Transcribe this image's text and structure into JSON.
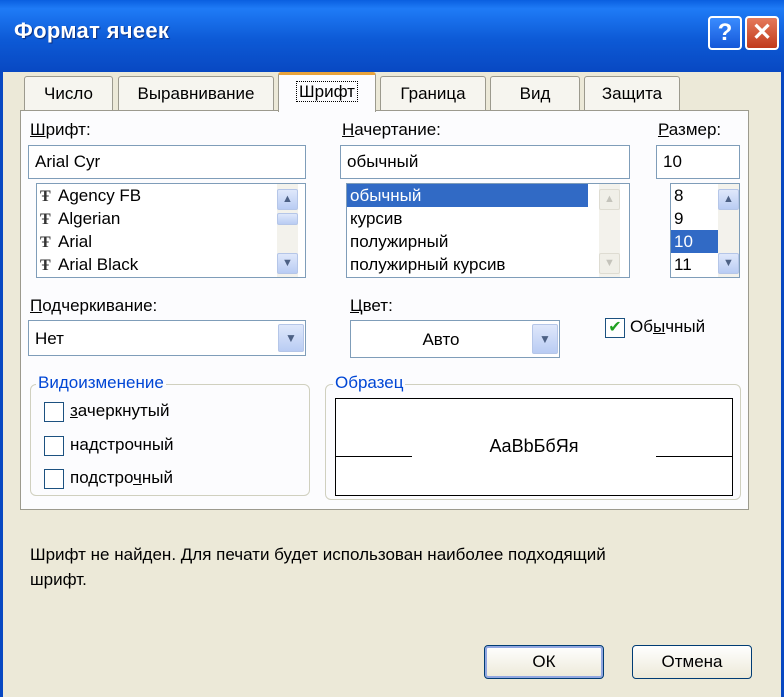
{
  "window": {
    "title": "Формат ячеек",
    "help_label": "?",
    "close_label": "✕"
  },
  "tabs": [
    {
      "label": "Число"
    },
    {
      "label": "Выравнивание"
    },
    {
      "label": "Шрифт",
      "active": true
    },
    {
      "label": "Граница"
    },
    {
      "label": "Вид"
    },
    {
      "label": "Защита"
    }
  ],
  "font": {
    "label_first": "Ш",
    "label_rest": "рифт:",
    "value": "Arial Cyr",
    "items": [
      "Agency FB",
      "Algerian",
      "Arial",
      "Arial Black"
    ],
    "icon_glyph": "Ŧ"
  },
  "style": {
    "label_first": "Н",
    "label_rest": "ачертание:",
    "value": "обычный",
    "items": [
      "обычный",
      "курсив",
      "полужирный",
      "полужирный курсив"
    ],
    "selected": "обычный"
  },
  "size": {
    "label_first": "Р",
    "label_rest": "азмер:",
    "value": "10",
    "items": [
      "8",
      "9",
      "10",
      "11"
    ],
    "selected": "10"
  },
  "underline": {
    "label_first": "П",
    "label_rest": "одчеркивание:",
    "value": "Нет"
  },
  "color": {
    "label_first": "Ц",
    "label_rest": "вет:",
    "value": "Авто"
  },
  "normal": {
    "label_a": "Об",
    "label_u": "ы",
    "label_b": "чный",
    "checked": true,
    "check_glyph": "✔",
    "check_color": "#21a121"
  },
  "effects": {
    "title": "Видоизменение",
    "strike": {
      "u": "з",
      "rest": "ачеркнутый",
      "checked": false
    },
    "super": {
      "pre": "на",
      "u": "д",
      "rest": "строчный",
      "checked": false
    },
    "sub": {
      "pre": "подстро",
      "u": "ч",
      "rest": "ный",
      "checked": false
    }
  },
  "sample": {
    "title": "Образец",
    "text": "AaBbБбЯя"
  },
  "message": {
    "line1": "Шрифт не найден. Для печати будет использован наиболее подходящий",
    "line2": "шрифт."
  },
  "buttons": {
    "ok": "ОК",
    "cancel": "Отмена"
  },
  "icons": {
    "scroll_up": "▲",
    "scroll_down": "▼",
    "dropdown": "▼"
  },
  "colors": {
    "titlebar": "#0a5fe0",
    "selection": "#316ac5",
    "group_title": "#0046d5",
    "tab_highlight": "#e8a33c"
  }
}
